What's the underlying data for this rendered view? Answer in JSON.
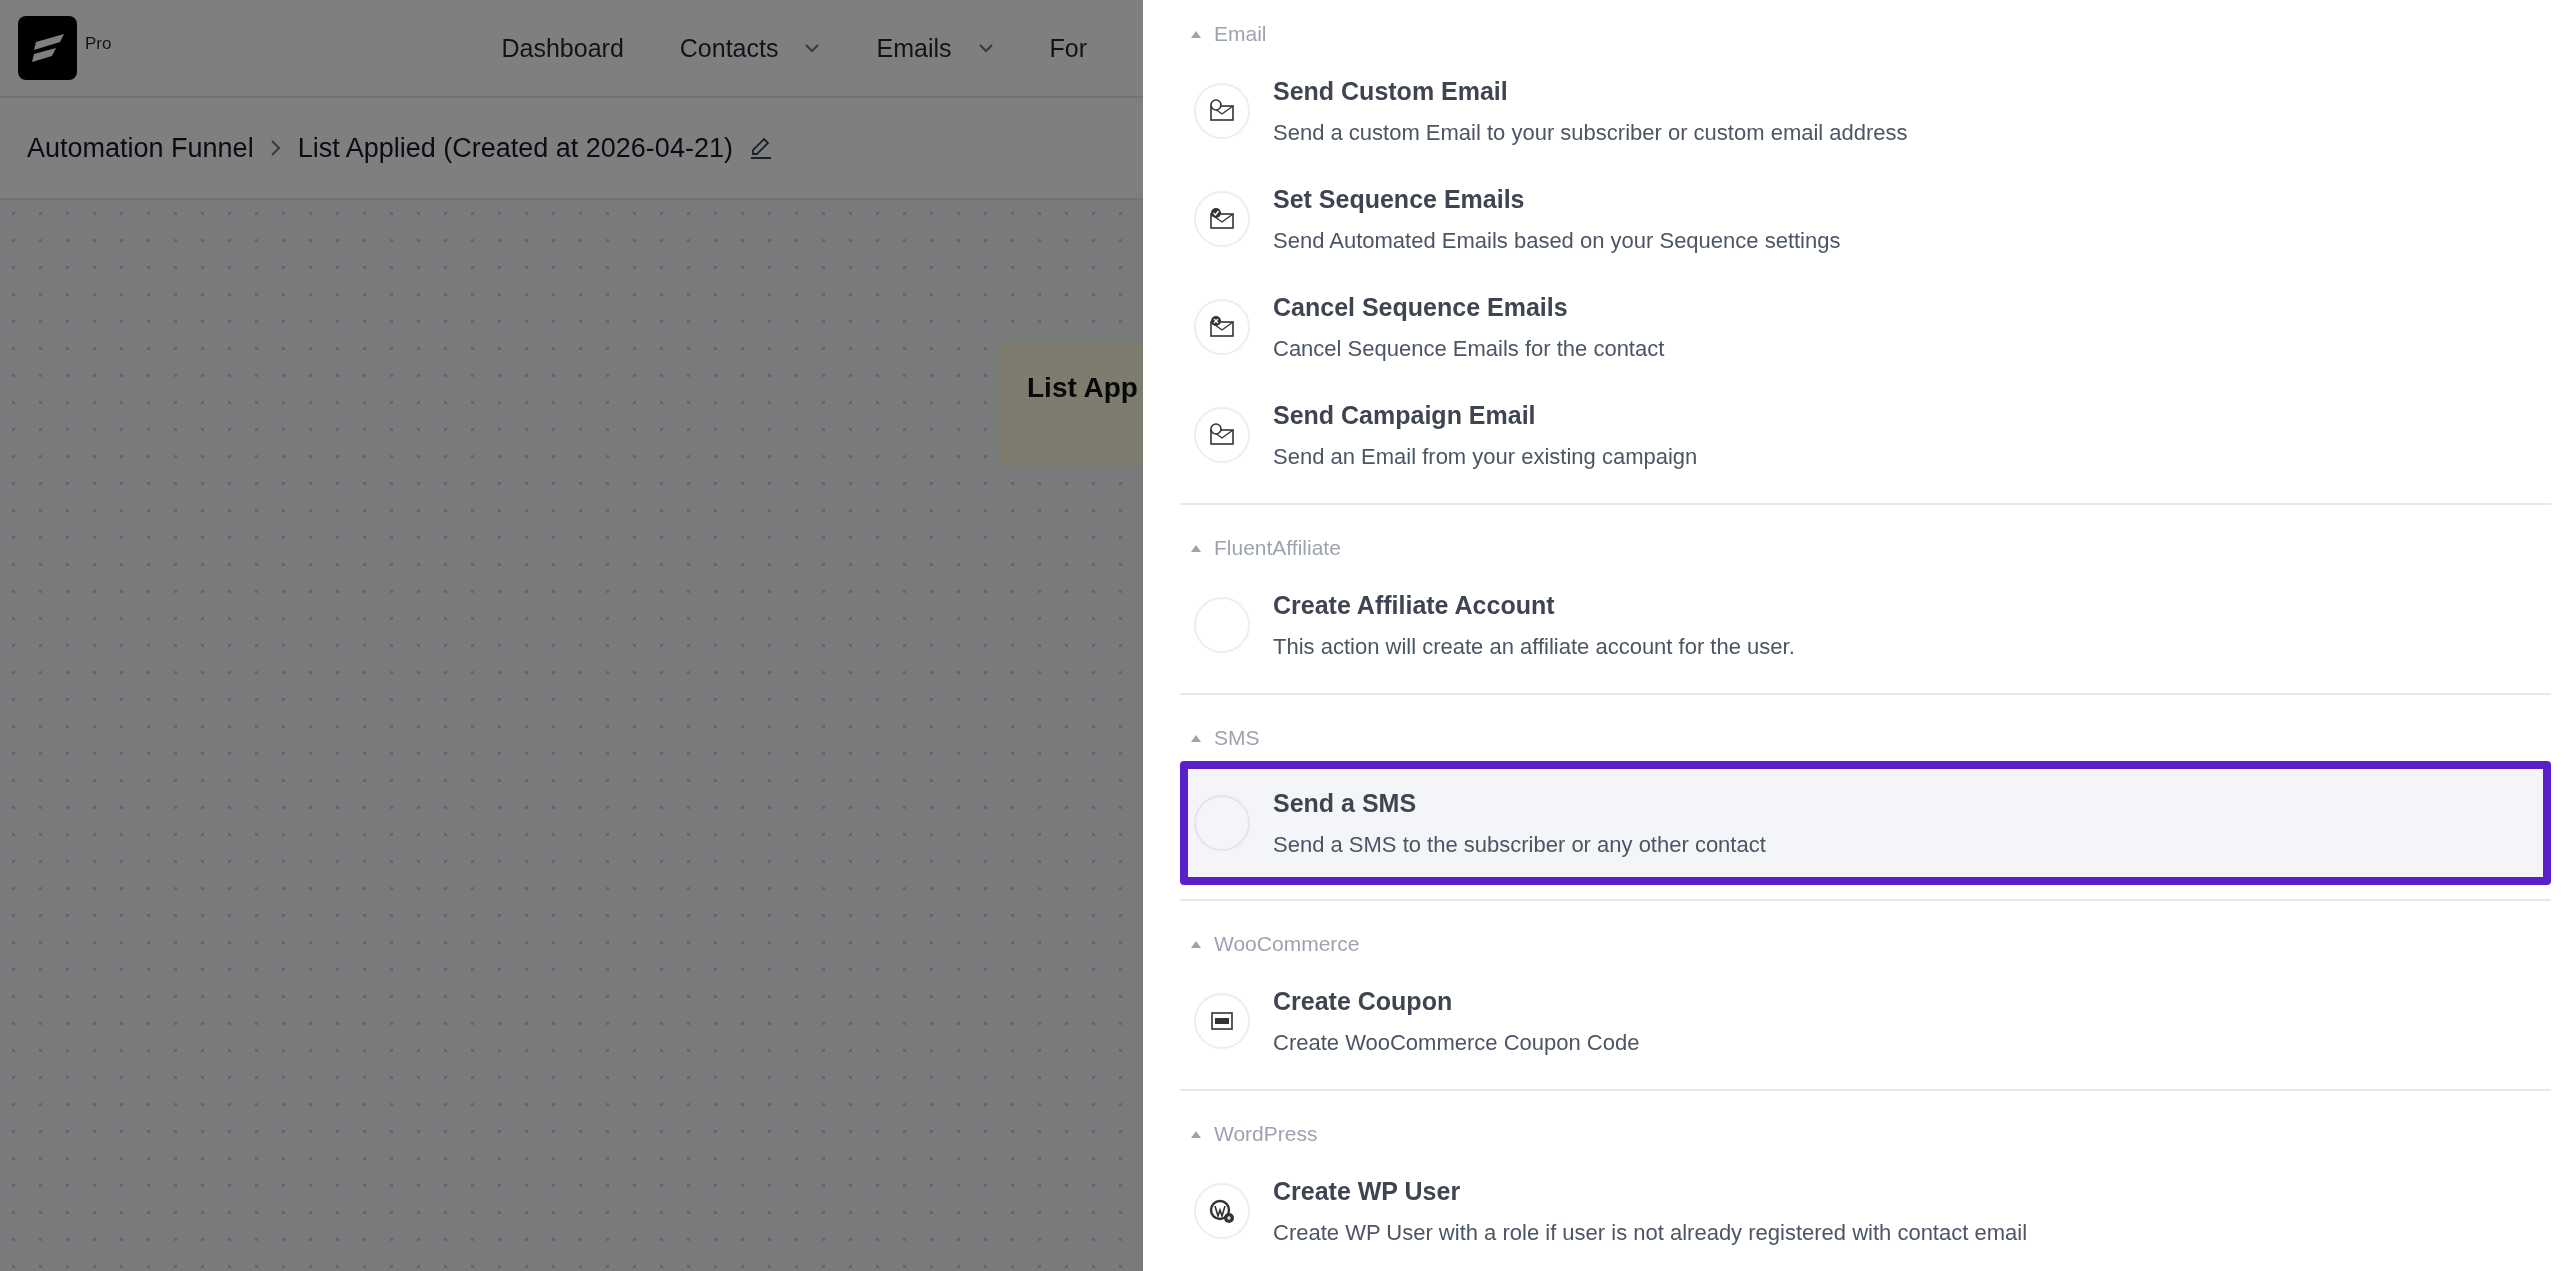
{
  "header": {
    "logo_badge": "Pro",
    "nav": [
      {
        "label": "Dashboard",
        "dropdown": false
      },
      {
        "label": "Contacts",
        "dropdown": true
      },
      {
        "label": "Emails",
        "dropdown": true
      },
      {
        "label": "For",
        "dropdown": false
      }
    ]
  },
  "breadcrumb": {
    "items": [
      "Automation Funnel",
      "List Applied (Created at 2026-04-21)"
    ],
    "editable": true
  },
  "canvas": {
    "node": {
      "title": "List App"
    }
  },
  "drawer": {
    "sections": [
      {
        "title": "Email",
        "expanded": true,
        "items": [
          {
            "kind": "send",
            "title": "Send Custom Email",
            "description": "Send a custom Email to your subscriber or custom email address",
            "selected": false
          },
          {
            "kind": "sequence",
            "title": "Set Sequence Emails",
            "description": "Send Automated Emails based on your Sequence settings",
            "selected": false
          },
          {
            "kind": "cancel",
            "title": "Cancel Sequence Emails",
            "description": "Cancel Sequence Emails for the contact",
            "selected": false
          },
          {
            "kind": "send",
            "title": "Send Campaign Email",
            "description": "Send an Email from your existing campaign",
            "selected": false
          }
        ]
      },
      {
        "title": "FluentAffiliate",
        "expanded": true,
        "items": [
          {
            "kind": "blank",
            "title": "Create Affiliate Account",
            "description": "This action will create an affiliate account for the user.",
            "selected": false
          }
        ]
      },
      {
        "title": "SMS",
        "expanded": true,
        "items": [
          {
            "kind": "blank",
            "title": "Send a SMS",
            "description": "Send a SMS to the subscriber or any other contact",
            "selected": true
          }
        ]
      },
      {
        "title": "WooCommerce",
        "expanded": true,
        "items": [
          {
            "kind": "coupon",
            "title": "Create Coupon",
            "description": "Create WooCommerce Coupon Code",
            "selected": false
          }
        ]
      },
      {
        "title": "WordPress",
        "expanded": true,
        "items": [
          {
            "kind": "wordpress",
            "title": "Create WP User",
            "description": "Create WP User with a role if user is not already registered with contact email",
            "selected": false
          }
        ]
      }
    ]
  }
}
